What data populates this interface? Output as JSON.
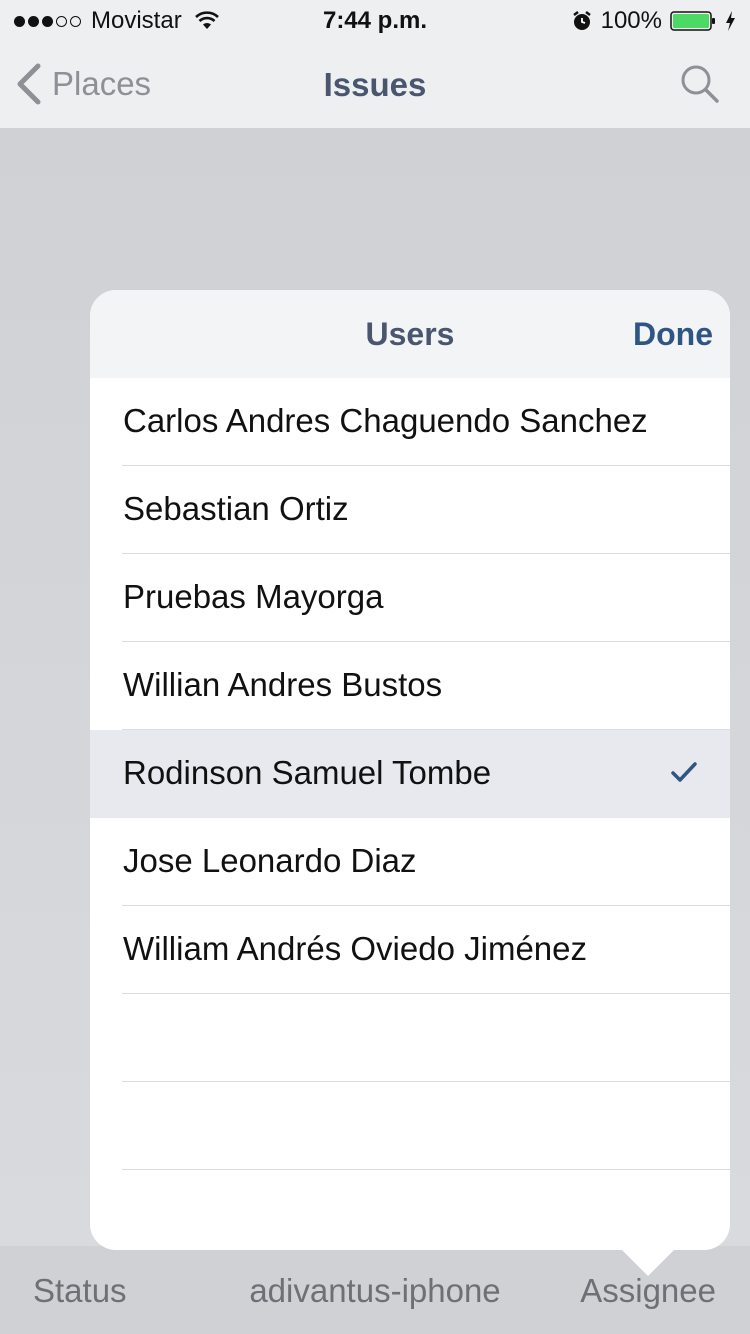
{
  "status_bar": {
    "carrier": "Movistar",
    "time": "7:44 p.m.",
    "battery": "100%"
  },
  "nav": {
    "back_label": "Places",
    "title": "Issues"
  },
  "popover": {
    "title": "Users",
    "done_label": "Done",
    "users": [
      {
        "name": "Carlos Andres Chaguendo Sanchez",
        "selected": false
      },
      {
        "name": "Sebastian Ortiz",
        "selected": false
      },
      {
        "name": "Pruebas Mayorga",
        "selected": false
      },
      {
        "name": "Willian Andres Bustos",
        "selected": false
      },
      {
        "name": "Rodinson Samuel Tombe",
        "selected": true
      },
      {
        "name": "Jose Leonardo Diaz",
        "selected": false
      },
      {
        "name": "William Andrés Oviedo Jiménez",
        "selected": false
      }
    ]
  },
  "toolbar": {
    "status_label": "Status",
    "project_label": "adivantus-iphone",
    "assignee_label": "Assignee"
  },
  "colors": {
    "accent": "#2f5584",
    "title": "#4a5570",
    "battery_fill": "#4cd964"
  }
}
